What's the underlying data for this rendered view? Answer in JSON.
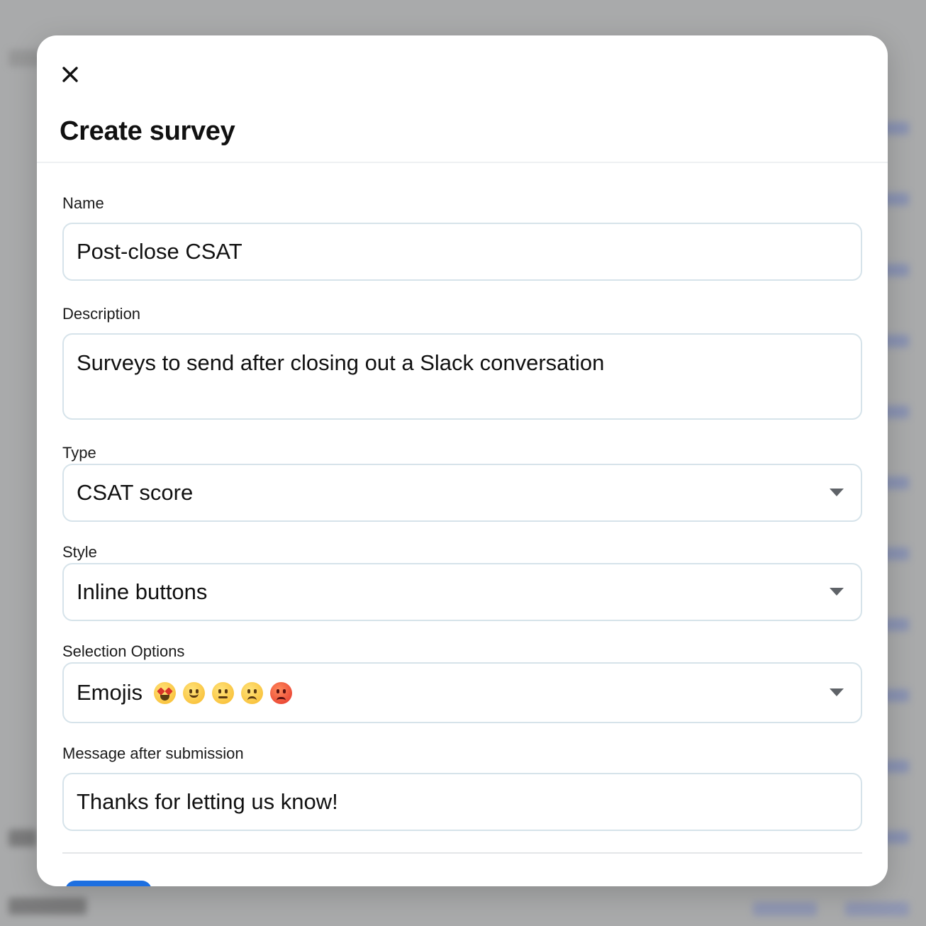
{
  "modal": {
    "title": "Create survey",
    "close_icon": "close-icon"
  },
  "form": {
    "name": {
      "label": "Name",
      "value": "Post-close CSAT"
    },
    "description": {
      "label": "Description",
      "value": "Surveys to send after closing out a Slack conversation"
    },
    "type": {
      "label": "Type",
      "value": "CSAT score"
    },
    "style": {
      "label": "Style",
      "value": "Inline buttons"
    },
    "selection_options": {
      "label": "Selection Options",
      "value": "Emojis",
      "emojis": [
        "star-struck-emoji",
        "slightly-smiling-emoji",
        "neutral-emoji",
        "disappointed-emoji",
        "angry-emoji"
      ]
    },
    "message_after_submission": {
      "label": "Message after submission",
      "value": "Thanks for letting us know!"
    }
  },
  "colors": {
    "primary": "#1d6fe0",
    "field_border": "#d6e3ea",
    "overlay": "#a9aaab"
  }
}
